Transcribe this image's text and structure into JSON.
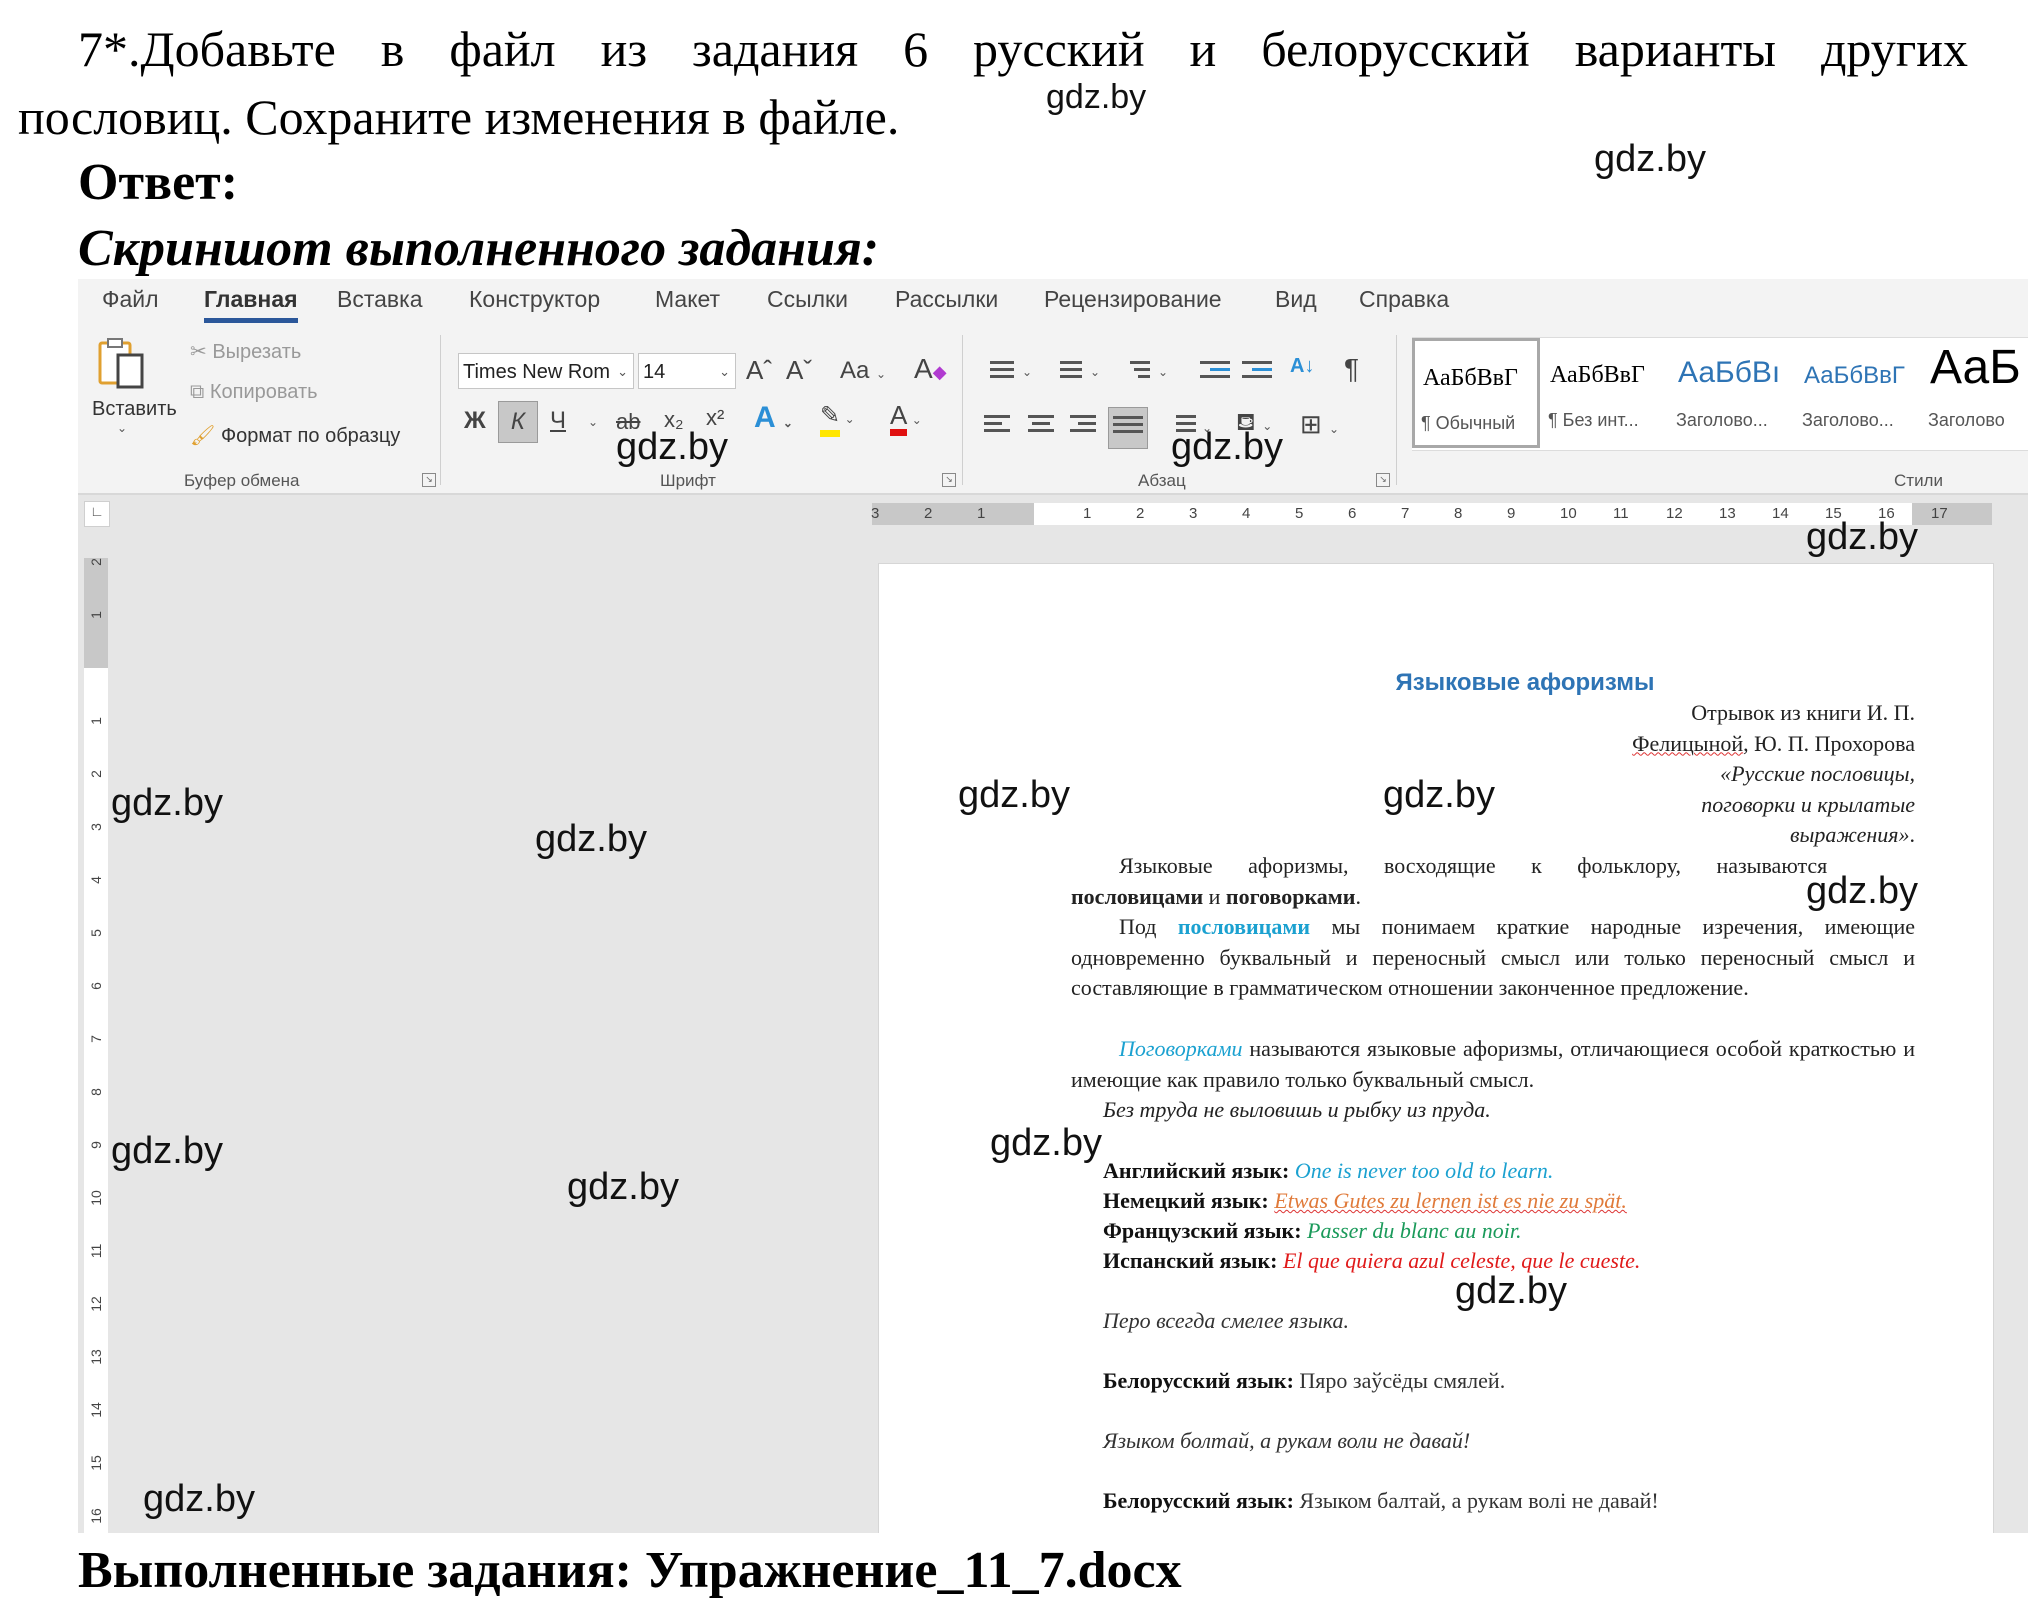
{
  "task": {
    "line1": "7*.Добавьте в файл из задания 6 русский и белорусский варианты других",
    "line2": "пословиц. Сохраните изменения в файле.",
    "answer_label": "Ответ:",
    "screenshot_label": "Скриншот выполненного задания:",
    "footer": "Выполненные задания: Упражнение_11_7.docx"
  },
  "watermark": "gdz.by",
  "word": {
    "tabs": [
      {
        "label": "Файл"
      },
      {
        "label": "Главная",
        "active": true
      },
      {
        "label": "Вставка"
      },
      {
        "label": "Конструктор"
      },
      {
        "label": "Макет"
      },
      {
        "label": "Ссылки"
      },
      {
        "label": "Рассылки"
      },
      {
        "label": "Рецензирование"
      },
      {
        "label": "Вид"
      },
      {
        "label": "Справка"
      }
    ],
    "clipboard": {
      "paste": "Вставить",
      "cut": "Вырезать",
      "copy": "Копировать",
      "format_painter": "Формат по образцу",
      "group": "Буфер обмена"
    },
    "font": {
      "name": "Times New Rom",
      "size": "14",
      "grow": "Aˆ",
      "shrink": "Aˇ",
      "case": "Aa",
      "bold": "Ж",
      "italic": "К",
      "underline": "Ч",
      "strike": "ab",
      "subscript": "x₂",
      "superscript": "x²",
      "effects": "A",
      "highlight_color": "#ffe600",
      "font_color": "#e01010",
      "color_letter": "A",
      "group": "Шрифт"
    },
    "paragraph": {
      "sort": "А↓",
      "pilcrow": "¶",
      "group": "Абзац"
    },
    "styles": {
      "items": [
        {
          "sample": "АаБбВвГ",
          "name": "¶ Обычный",
          "selected": true
        },
        {
          "sample": "АаБбВвГ",
          "name": "¶ Без инт..."
        },
        {
          "sample": "АаБбВı",
          "name": "Заголово..."
        },
        {
          "sample": "АаБбВвГ",
          "name": "Заголово..."
        },
        {
          "sample": "АаБ",
          "name": "Заголово"
        }
      ],
      "group": "Стили"
    },
    "hruler_labels": [
      "3",
      "2",
      "1",
      "1",
      "2",
      "3",
      "4",
      "5",
      "6",
      "7",
      "8",
      "9",
      "10",
      "11",
      "12",
      "13",
      "14",
      "15",
      "16",
      "17"
    ],
    "vruler_labels": [
      "2",
      "1",
      "1",
      "2",
      "3",
      "4",
      "5",
      "6",
      "7",
      "8",
      "9",
      "10",
      "11",
      "12",
      "13",
      "14",
      "15",
      "16"
    ],
    "doc": {
      "title": "Языковые афоризмы",
      "source_lines": [
        "Отрывок из книги И. П.",
        "Фелицыной, Ю. П. Прохорова",
        "«Русские пословицы,",
        "поговорки и крылатые",
        "выражения»."
      ],
      "p1_text": "Языковые афоризмы, восходящие к фольклору, называются",
      "p1_bold": "пословицами",
      "p1_mid": " и ",
      "p1_bold2": "поговорками",
      "p1_end": ".",
      "p2_start": "Под ",
      "p2_highlight": "пословицами",
      "p2_rest": " мы понимаем краткие народные изречения, имеющие одновременно буквальный и переносный смысл или только переносный смысл и составляющие в грамматическом отношении законченное предложение.",
      "p3_highlight": "Поговорками",
      "p3_rest": " называются языковые афоризмы, отличающиеся особой краткостью и имеющие как правило только буквальный смысл.",
      "proverb1": "Без труда не выловишь и рыбку из пруда.",
      "translations": [
        {
          "label": "Английский язык:",
          "text": "One is never too old to learn.",
          "color": "#1ba1d0"
        },
        {
          "label": "Немецкий язык:",
          "text": "Etwas Gutes zu lernen ist es nie zu spät.",
          "color": "#e07a3a"
        },
        {
          "label": "Французский язык:",
          "text": "Passer du blanc au noir.",
          "color": "#1a9a5a"
        },
        {
          "label": "Испанский язык:",
          "text": "El que quiera azul celeste, que le cueste.",
          "color": "#e01a1a"
        }
      ],
      "proverb2": "Перо всегда смелее языка.",
      "by1_label": "Белорусский язык:",
      "by1_text": "Пяро заўсёды смялей.",
      "proverb3": "Языком болтай, а рукам воли не давай!",
      "by2_label": "Белорусский язык:",
      "by2_text": "Языком балтай, а рукам волі не давай!"
    }
  }
}
